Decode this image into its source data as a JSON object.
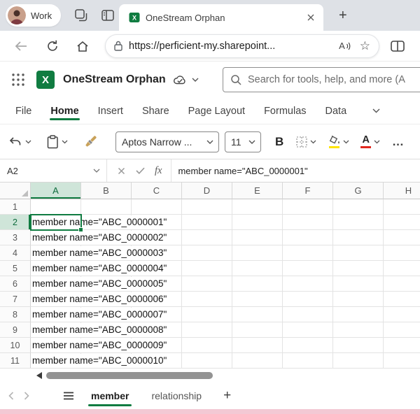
{
  "colors": {
    "excel_green": "#107C41",
    "header_highlight": "#CFE5D9",
    "grid_line": "#E3E3E3",
    "fill_yellow": "#FFE400",
    "font_red": "#E0281E",
    "tabstrip_bg": "#DEE1E6",
    "bottom_strip": "#F3C9D4"
  },
  "icons": {
    "excel_logo_letter": "X",
    "star": "☆",
    "read_aloud_letter": "A",
    "more_dots": "…"
  },
  "browser": {
    "profile_name": "Work",
    "tab_title": "OneStream Orphan",
    "new_tab": "+",
    "url": "https://perficient-my.sharepoint..."
  },
  "header": {
    "app_title": "OneStream Orphan",
    "search_placeholder": "Search for tools, help, and more (A"
  },
  "menu": {
    "items": [
      {
        "label": "File",
        "active": false
      },
      {
        "label": "Home",
        "active": true
      },
      {
        "label": "Insert",
        "active": false
      },
      {
        "label": "Share",
        "active": false
      },
      {
        "label": "Page Layout",
        "active": false
      },
      {
        "label": "Formulas",
        "active": false
      },
      {
        "label": "Data",
        "active": false
      }
    ]
  },
  "ribbon": {
    "font_name": "Aptos Narrow ...",
    "font_size": "11",
    "bold_label": "B",
    "font_color_label": "A"
  },
  "formula_bar": {
    "name_box": "A2",
    "fx_label": "fx",
    "formula": "member name=\"ABC_0000001\""
  },
  "grid": {
    "columns": [
      "A",
      "B",
      "C",
      "D",
      "E",
      "F",
      "G",
      "H"
    ],
    "active_cell": "A2",
    "rows": [
      {
        "n": "1",
        "text": ""
      },
      {
        "n": "2",
        "text": "member name=\"ABC_0000001\""
      },
      {
        "n": "3",
        "text": "member name=\"ABC_0000002\""
      },
      {
        "n": "4",
        "text": "member name=\"ABC_0000003\""
      },
      {
        "n": "5",
        "text": "member name=\"ABC_0000004\""
      },
      {
        "n": "6",
        "text": "member name=\"ABC_0000005\""
      },
      {
        "n": "7",
        "text": "member name=\"ABC_0000006\""
      },
      {
        "n": "8",
        "text": "member name=\"ABC_0000007\""
      },
      {
        "n": "9",
        "text": "member name=\"ABC_0000008\""
      },
      {
        "n": "10",
        "text": "member name=\"ABC_0000009\""
      },
      {
        "n": "11",
        "text": "member name=\"ABC_0000010\""
      }
    ]
  },
  "sheet_bar": {
    "tabs": [
      {
        "label": "member",
        "active": true
      },
      {
        "label": "relationship",
        "active": false
      }
    ],
    "add_label": "+"
  }
}
